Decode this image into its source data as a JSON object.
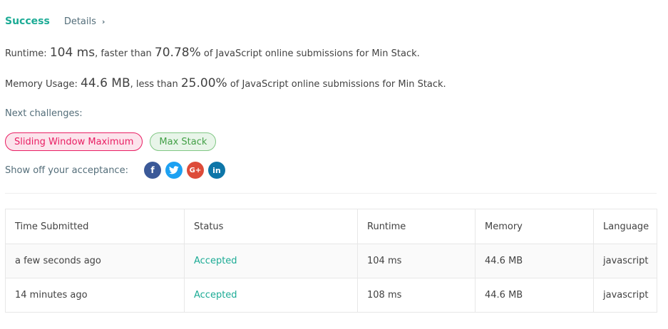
{
  "header": {
    "status": "Success",
    "details_label": "Details",
    "details_chevron": "›"
  },
  "runtime": {
    "label": "Runtime: ",
    "value": "104 ms",
    "comparison": ", faster than ",
    "percentile": "70.78%",
    "suffix": " of JavaScript online submissions for Min Stack."
  },
  "memory": {
    "label": "Memory Usage: ",
    "value": "44.6 MB",
    "comparison": ", less than ",
    "percentile": "25.00%",
    "suffix": " of JavaScript online submissions for Min Stack."
  },
  "next_challenges": {
    "label": "Next challenges:",
    "items": [
      {
        "label": "Sliding Window Maximum",
        "difficulty": "hard",
        "color": "#e91e63"
      },
      {
        "label": "Max Stack",
        "difficulty": "medium",
        "color": "#43a047"
      }
    ]
  },
  "share": {
    "label": "Show off your acceptance:",
    "icons": [
      {
        "name": "facebook-icon",
        "glyph": "f",
        "color": "#3b5998"
      },
      {
        "name": "twitter-icon",
        "glyph": "t",
        "color": "#1da1f2"
      },
      {
        "name": "google-plus-icon",
        "glyph": "G+",
        "color": "#dd4b39"
      },
      {
        "name": "linkedin-icon",
        "glyph": "in",
        "color": "#0e76a8"
      }
    ]
  },
  "submissions": {
    "columns": [
      "Time Submitted",
      "Status",
      "Runtime",
      "Memory",
      "Language"
    ],
    "rows": [
      {
        "time": "a few seconds ago",
        "status": "Accepted",
        "runtime": "104 ms",
        "memory": "44.6 MB",
        "language": "javascript"
      },
      {
        "time": "14 minutes ago",
        "status": "Accepted",
        "runtime": "108 ms",
        "memory": "44.6 MB",
        "language": "javascript"
      }
    ]
  },
  "colors": {
    "success": "#1cab95",
    "accepted": "#1cab95"
  }
}
